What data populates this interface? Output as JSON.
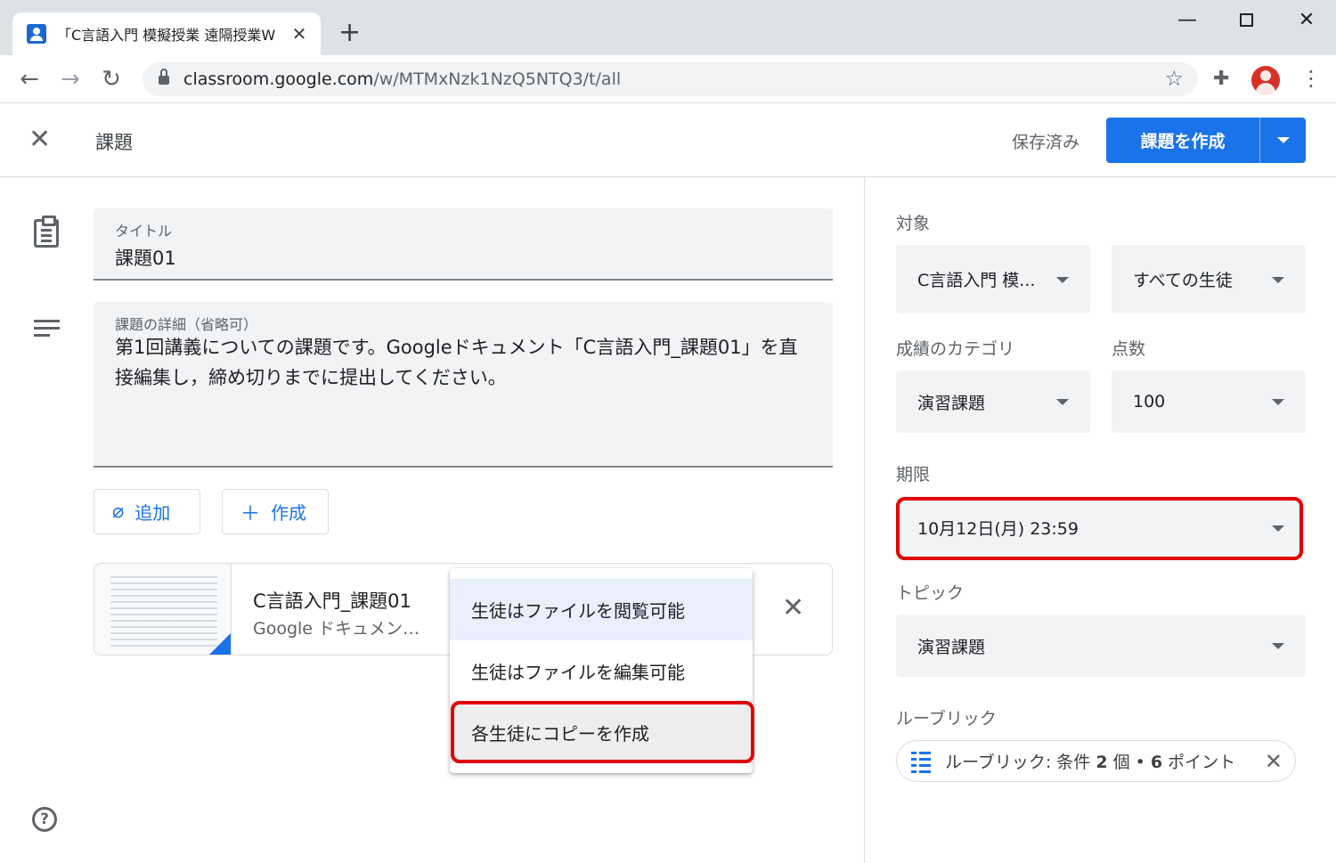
{
  "browser": {
    "tab_title": "「C言語入門 模擬授業 遠隔授業W",
    "url_host": "classroom.google.com",
    "url_path": "/w/MTMxNzk1NzQ5NTQ3/t/all"
  },
  "header": {
    "title": "課題",
    "saved": "保存済み",
    "create_label": "課題を作成"
  },
  "form": {
    "title_label": "タイトル",
    "title_value": "課題01",
    "desc_label": "課題の詳細（省略可）",
    "desc_value": "第1回講義についての課題です。Googleドキュメント「C言語入門_課題01」を直接編集し，締め切りまでに提出してください。",
    "add_label": "追加",
    "create_label": "作成"
  },
  "attachment": {
    "name": "C言語入門_課題01",
    "type": "Google ドキュメン…"
  },
  "share_menu": {
    "items": [
      "生徒はファイルを閲覧可能",
      "生徒はファイルを編集可能",
      "各生徒にコピーを作成"
    ],
    "selected_index": 0,
    "hovered_index": 2
  },
  "panel": {
    "for_label": "対象",
    "class_value": "C言語入門 模...",
    "students_value": "すべての生徒",
    "grade_category_label": "成績のカテゴリ",
    "grade_category_value": "演習課題",
    "points_label": "点数",
    "points_value": "100",
    "due_label": "期限",
    "due_value": "10月12日(月) 23:59",
    "topic_label": "トピック",
    "topic_value": "演習課題",
    "rubric_label": "ルーブリック",
    "rubric_prefix": "ルーブリック: 条件 ",
    "rubric_criteria": "2",
    "rubric_mid": " 個 • ",
    "rubric_points": "6",
    "rubric_suffix": " ポイント"
  },
  "colors": {
    "accent": "#1a73e8",
    "highlight": "#e00000",
    "field_bg": "#f1f3f4"
  }
}
